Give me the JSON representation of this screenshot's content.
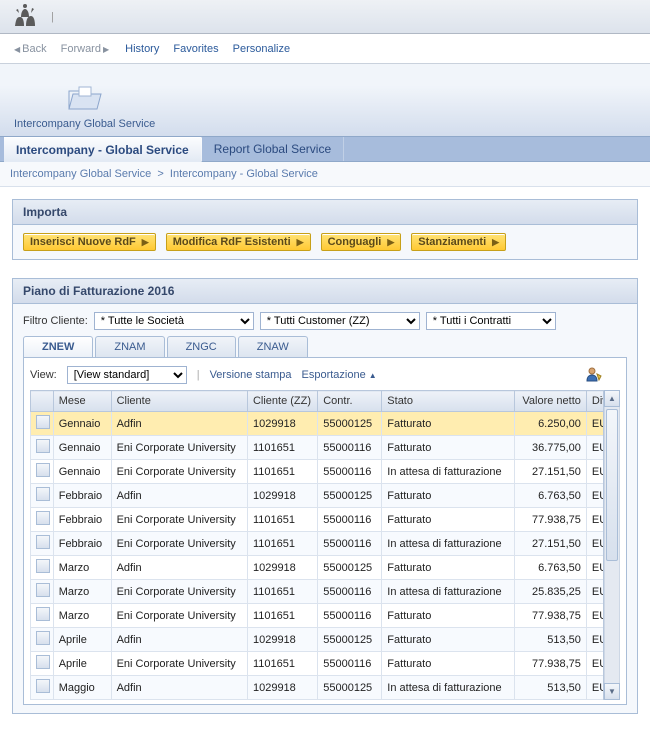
{
  "topnav": {
    "back": "Back",
    "forward": "Forward",
    "history": "History",
    "favorites": "Favorites",
    "personalize": "Personalize"
  },
  "foldertab": {
    "label": "Intercompany Global Service"
  },
  "subtabs": {
    "active": "Intercompany - Global Service",
    "second": "Report Global Service"
  },
  "breadcrumb": {
    "a": "Intercompany Global Service",
    "sep": ">",
    "b": "Intercompany - Global Service"
  },
  "importa": {
    "title": "Importa",
    "buttons": {
      "b1": "Inserisci Nuove RdF",
      "b2": "Modifica RdF Esistenti",
      "b3": "Conguagli",
      "b4": "Stanziamenti"
    }
  },
  "piano": {
    "title": "Piano di Fatturazione 2016",
    "filterLabel": "Filtro Cliente:",
    "sel1": "* Tutte le Società",
    "sel2": "* Tutti Customer (ZZ)",
    "sel3": "* Tutti i Contratti",
    "tabs": {
      "t1": "ZNEW",
      "t2": "ZNAM",
      "t3": "ZNGC",
      "t4": "ZNAW"
    },
    "viewLabel": "View:",
    "viewSel": "[View standard]",
    "versione": "Versione stampa",
    "export": "Esportazione",
    "columns": {
      "mese": "Mese",
      "cliente": "Cliente",
      "clientezz": "Cliente (ZZ)",
      "contr": "Contr.",
      "stato": "Stato",
      "valore": "Valore netto",
      "div": "Div."
    },
    "rows": [
      {
        "mese": "Gennaio",
        "cliente": "Adfin",
        "czz": "1029918",
        "contr": "55000125",
        "stato": "Fatturato",
        "val": "6.250,00",
        "div": "EUR",
        "hl": true
      },
      {
        "mese": "Gennaio",
        "cliente": "Eni Corporate University",
        "czz": "1101651",
        "contr": "55000116",
        "stato": "Fatturato",
        "val": "36.775,00",
        "div": "EUR"
      },
      {
        "mese": "Gennaio",
        "cliente": "Eni Corporate University",
        "czz": "1101651",
        "contr": "55000116",
        "stato": "In attesa di fatturazione",
        "val": "27.151,50",
        "div": "EUR"
      },
      {
        "mese": "Febbraio",
        "cliente": "Adfin",
        "czz": "1029918",
        "contr": "55000125",
        "stato": "Fatturato",
        "val": "6.763,50",
        "div": "EUR"
      },
      {
        "mese": "Febbraio",
        "cliente": "Eni Corporate University",
        "czz": "1101651",
        "contr": "55000116",
        "stato": "Fatturato",
        "val": "77.938,75",
        "div": "EUR"
      },
      {
        "mese": "Febbraio",
        "cliente": "Eni Corporate University",
        "czz": "1101651",
        "contr": "55000116",
        "stato": "In attesa di fatturazione",
        "val": "27.151,50",
        "div": "EUR"
      },
      {
        "mese": "Marzo",
        "cliente": "Adfin",
        "czz": "1029918",
        "contr": "55000125",
        "stato": "Fatturato",
        "val": "6.763,50",
        "div": "EUR"
      },
      {
        "mese": "Marzo",
        "cliente": "Eni Corporate University",
        "czz": "1101651",
        "contr": "55000116",
        "stato": "In attesa di fatturazione",
        "val": "25.835,25",
        "div": "EUR"
      },
      {
        "mese": "Marzo",
        "cliente": "Eni Corporate University",
        "czz": "1101651",
        "contr": "55000116",
        "stato": "Fatturato",
        "val": "77.938,75",
        "div": "EUR"
      },
      {
        "mese": "Aprile",
        "cliente": "Adfin",
        "czz": "1029918",
        "contr": "55000125",
        "stato": "Fatturato",
        "val": "513,50",
        "div": "EUR"
      },
      {
        "mese": "Aprile",
        "cliente": "Eni Corporate University",
        "czz": "1101651",
        "contr": "55000116",
        "stato": "Fatturato",
        "val": "77.938,75",
        "div": "EUR"
      },
      {
        "mese": "Maggio",
        "cliente": "Adfin",
        "czz": "1029918",
        "contr": "55000125",
        "stato": "In attesa di fatturazione",
        "val": "513,50",
        "div": "EUR"
      }
    ]
  }
}
